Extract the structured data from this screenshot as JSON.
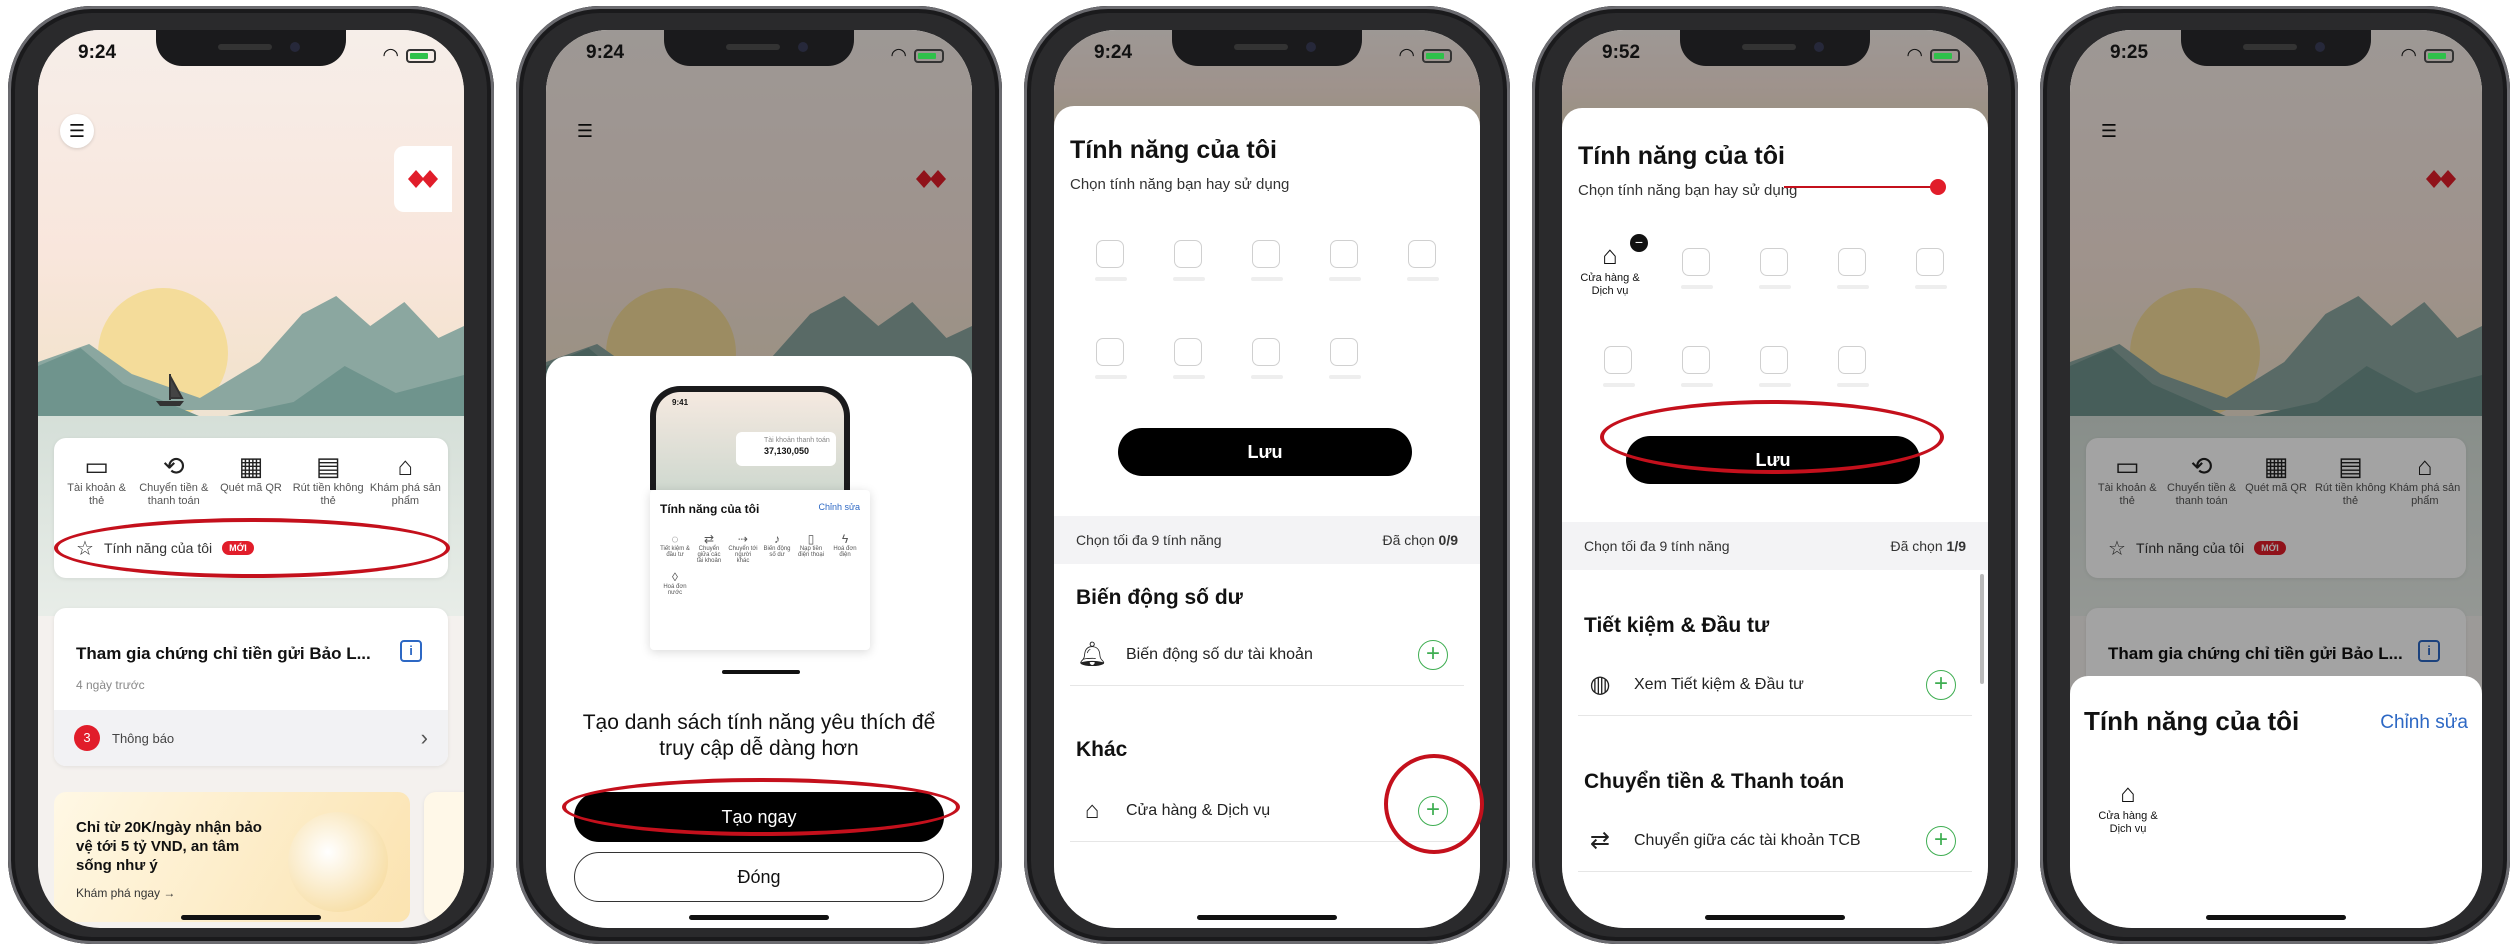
{
  "status_times": [
    "9:24",
    "9:24",
    "9:24",
    "9:52",
    "9:25"
  ],
  "home": {
    "quick_actions": [
      {
        "icon": "wallet-icon",
        "label": "Tài khoản & thẻ"
      },
      {
        "icon": "transfer-icon",
        "label": "Chuyển tiền & thanh toán"
      },
      {
        "icon": "qr-icon",
        "label": "Quét mã QR"
      },
      {
        "icon": "atm-icon",
        "label": "Rút tiền không thẻ"
      },
      {
        "icon": "bank-icon",
        "label": "Khám phá sản phẩm"
      }
    ],
    "favorites_label": "Tính năng của tôi",
    "new_badge": "MỚI",
    "notice_title": "Tham gia chứng chỉ tiền gửi Bảo L...",
    "notice_time": "4 ngày trước",
    "notice_count": "3",
    "notice_footer": "Thông báo",
    "promo_text": "Chỉ từ 20K/ngày nhận bảo vệ tới 5 tỷ VND, an tâm sống như ý",
    "promo_link": "Khám phá ngay →"
  },
  "intro": {
    "preview_time": "9:41",
    "preview_account_label": "Tài khoản thanh toán",
    "preview_balance": "37,130,050",
    "preview_title": "Tính năng của tôi",
    "preview_edit": "Chỉnh sửa",
    "preview_items": [
      "Tiết kiệm & đầu tư",
      "Chuyển giữa các tài khoản",
      "Chuyển tới người khác",
      "Biến động số dư",
      "Nạp tiền điện thoại",
      "Hoá đơn điện",
      "Hoá đơn nước"
    ],
    "headline": "Tạo danh sách tính năng yêu thích để truy cập dễ dàng hơn",
    "primary_button": "Tạo ngay",
    "secondary_button": "Đóng"
  },
  "picker": {
    "title": "Tính năng của tôi",
    "subtitle": "Chọn tính năng bạn hay sử dụng",
    "save_button": "Lưu",
    "limit_text": "Chọn tối đa 9 tính năng",
    "selected_prefix": "Đã chọn ",
    "selected_empty": "0/9",
    "selected_one": "1/9",
    "section_balance": "Biến động số dư",
    "row_balance": "Biến động số dư tài khoản",
    "section_other": "Khác",
    "row_store": "Cửa hàng & Dịch vụ",
    "selected_item": "Cửa hàng & Dịch vụ",
    "section_savings": "Tiết kiệm & Đầu tư",
    "row_savings": "Xem Tiết kiệm & Đầu tư",
    "section_transfer": "Chuyển tiền & Thanh toán",
    "row_transfer": "Chuyển giữa các tài khoản TCB"
  },
  "result": {
    "sheet_title": "Tính năng của tôi",
    "edit_link": "Chỉnh sửa",
    "item_label": "Cửa hàng & Dịch vụ"
  },
  "colors": {
    "brand_red": "#e11d2a",
    "annotation_red": "#c4101c",
    "plus_green": "#3fae52",
    "link_blue": "#2d68c4"
  }
}
